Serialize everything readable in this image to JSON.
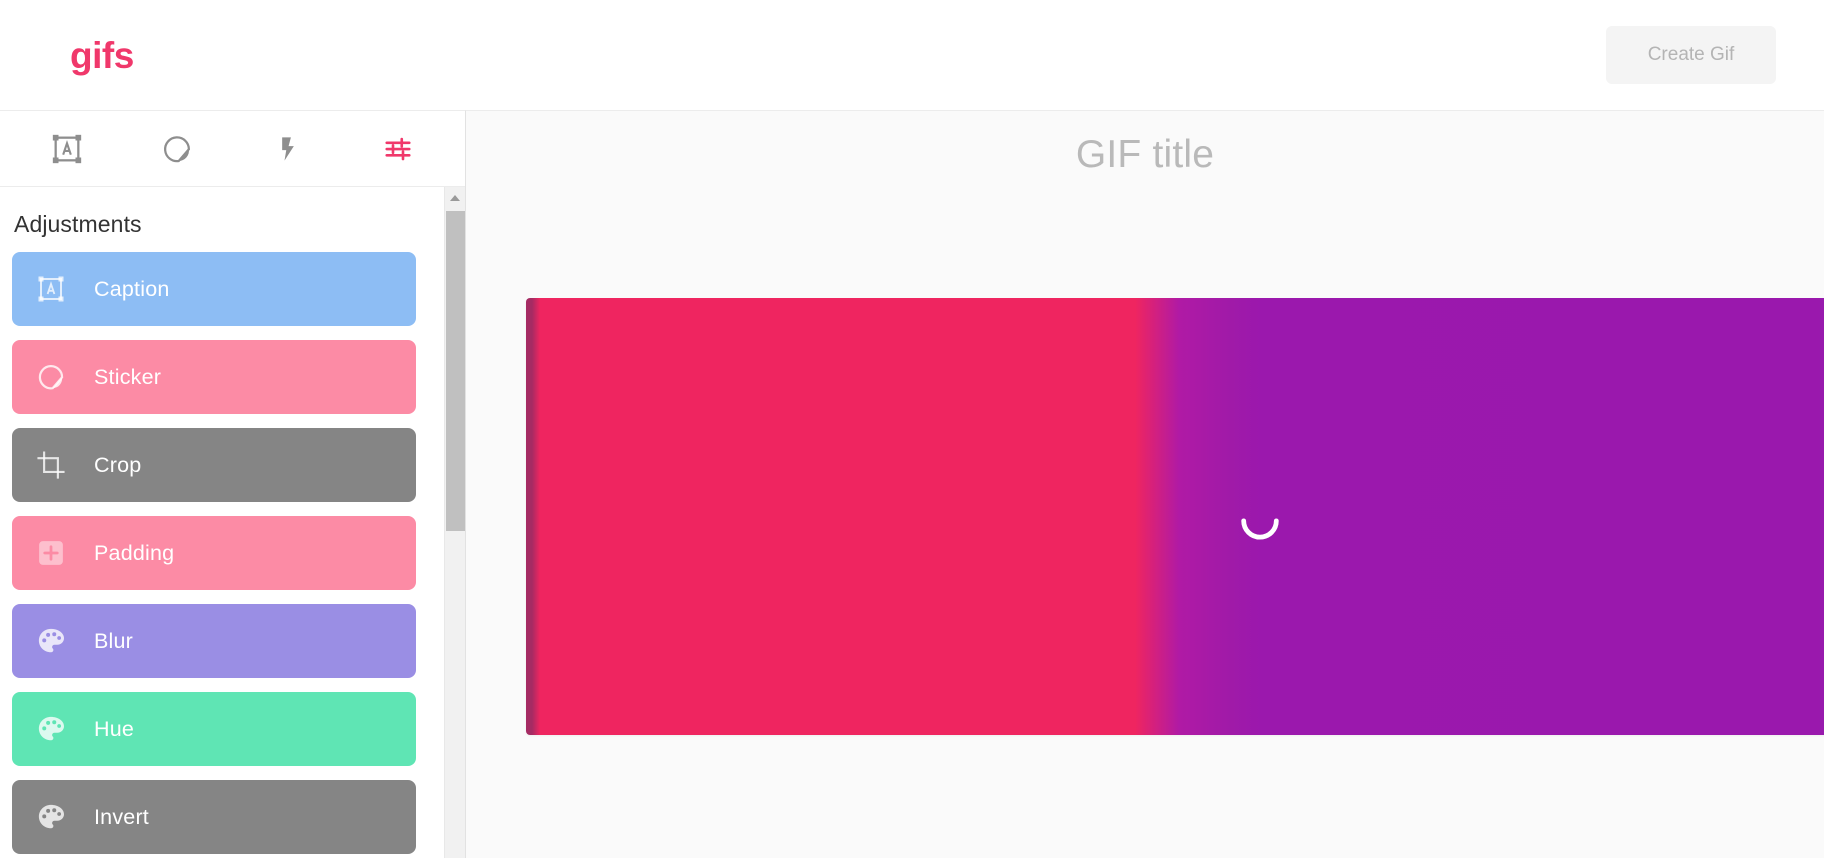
{
  "header": {
    "brand": "gifs",
    "create_button_label": "Create Gif"
  },
  "sidebar": {
    "tabs": [
      {
        "label": "Caption",
        "icon": "caption-icon",
        "active": false,
        "color": "#8e8e8e"
      },
      {
        "label": "Sticker",
        "icon": "sticker-icon",
        "active": false,
        "color": "#8e8e8e"
      },
      {
        "label": "Effects",
        "icon": "lightning-bolt-icon",
        "active": false,
        "color": "#8e8e8e"
      },
      {
        "label": "Adjustments",
        "icon": "sliders-icon",
        "active": true,
        "color": "#f0386b"
      }
    ],
    "panel_title": "Adjustments",
    "items": [
      {
        "label": "Caption",
        "icon": "caption-icon",
        "bg": "#8dbdf4"
      },
      {
        "label": "Sticker",
        "icon": "sticker-icon",
        "bg": "#fc8ba5"
      },
      {
        "label": "Crop",
        "icon": "crop-icon",
        "bg": "#858585"
      },
      {
        "label": "Padding",
        "icon": "padding-icon",
        "bg": "#fc8ba5"
      },
      {
        "label": "Blur",
        "icon": "palette-icon",
        "bg": "#9a8ee4"
      },
      {
        "label": "Hue",
        "icon": "palette-icon",
        "bg": "#5fe5b4"
      },
      {
        "label": "Invert",
        "icon": "palette-icon",
        "bg": "#858585"
      }
    ]
  },
  "stage": {
    "title_placeholder": "GIF title",
    "title_value": "",
    "preview": {
      "status": "loading",
      "colors": [
        "#a52b63",
        "#ef2560",
        "#b01aa5",
        "#9b18ad",
        "#6450b0"
      ]
    }
  },
  "theme": {
    "brand_color": "#f0386b",
    "stage_bg": "#fafafa",
    "panel_bg": "#ffffff"
  }
}
